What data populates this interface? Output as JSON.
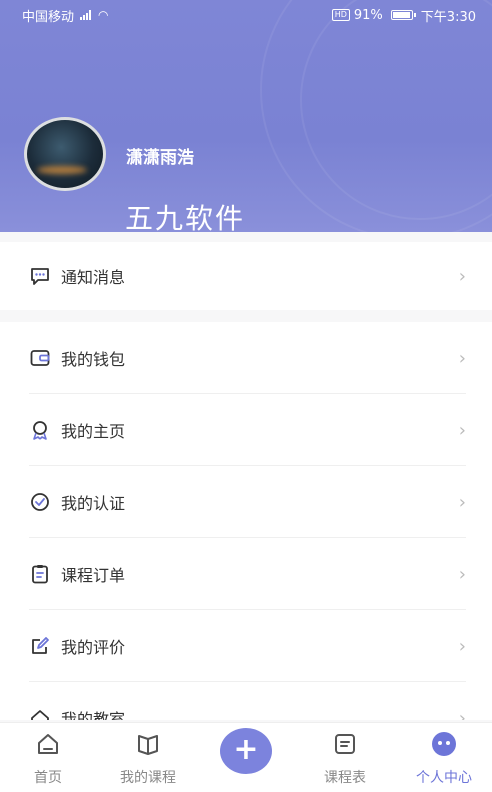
{
  "status_bar": {
    "carrier": "中国移动",
    "battery": "91%",
    "time": "下午3:30"
  },
  "profile": {
    "username": "潇潇雨浩",
    "watermark": "五九软件"
  },
  "notify": {
    "label": "通知消息",
    "icon": "chat-bubble-icon"
  },
  "menu": [
    {
      "label": "我的钱包",
      "icon": "wallet-icon"
    },
    {
      "label": "我的主页",
      "icon": "badge-icon"
    },
    {
      "label": "我的认证",
      "icon": "check-circle-icon"
    },
    {
      "label": "课程订单",
      "icon": "clipboard-icon"
    },
    {
      "label": "我的评价",
      "icon": "edit-icon"
    },
    {
      "label": "我的教室",
      "icon": "home-icon"
    }
  ],
  "tabbar": {
    "home": "首页",
    "my_courses": "我的课程",
    "schedule": "课程表",
    "profile": "个人中心"
  },
  "colors": {
    "header": "#7f86d6",
    "accent": "#6d75d8"
  }
}
